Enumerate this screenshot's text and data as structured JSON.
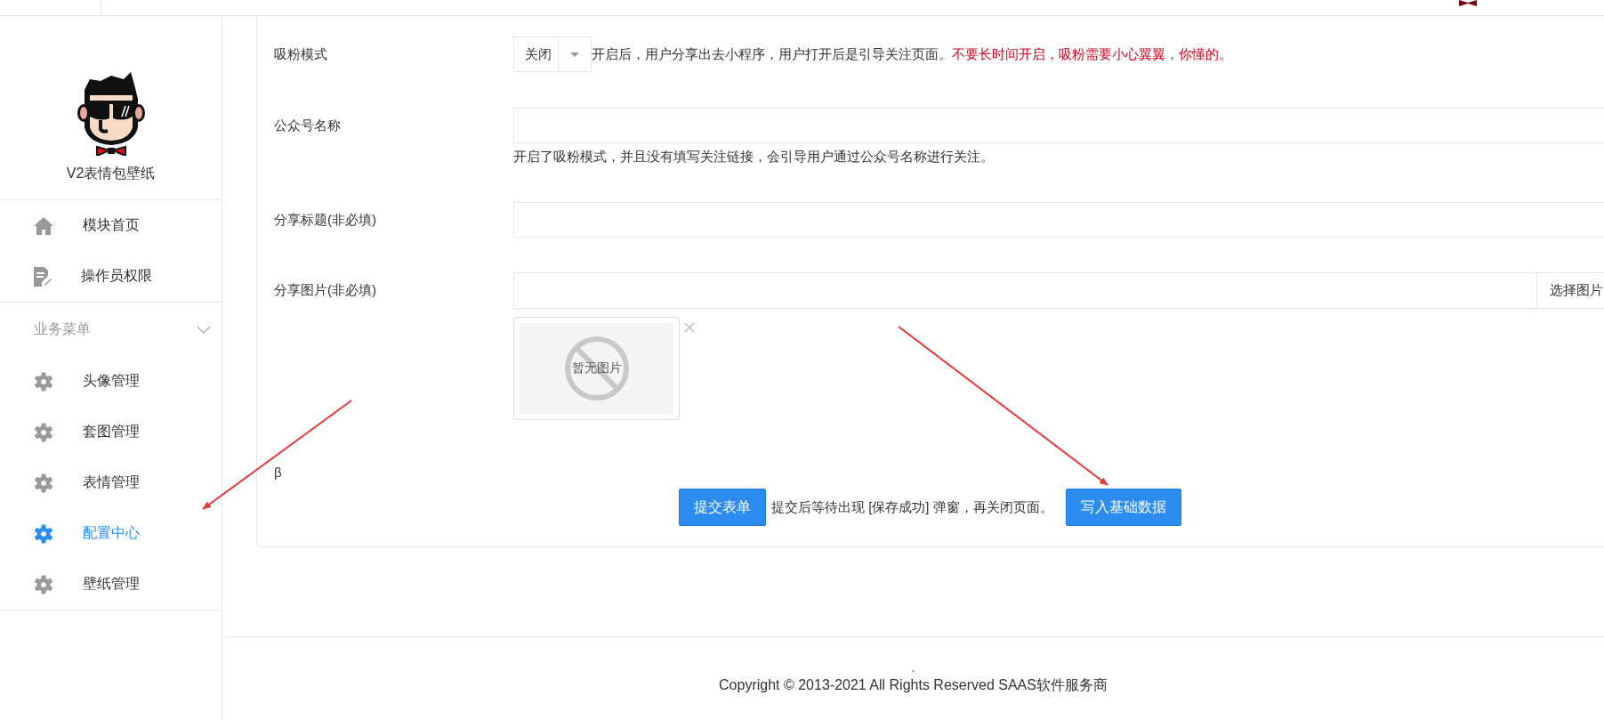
{
  "sidebar": {
    "app_name": "V2表情包壁纸",
    "items": [
      {
        "label": "模块首页",
        "selected": false
      },
      {
        "label": "操作员权限",
        "selected": false
      }
    ],
    "section": {
      "title": "业务菜单",
      "expanded": true,
      "items": [
        {
          "label": "头像管理",
          "selected": false
        },
        {
          "label": "套图管理",
          "selected": false
        },
        {
          "label": "表情管理",
          "selected": false
        },
        {
          "label": "配置中心",
          "selected": true
        },
        {
          "label": "壁纸管理",
          "selected": false
        }
      ]
    }
  },
  "form": {
    "rows": [
      {
        "kind": "select",
        "label": "吸粉模式",
        "value": "关闭",
        "hint": "开启后，用户分享出去小程序，用户打开后是引导关注页面。",
        "warning": "不要长时间开启，吸粉需要小心翼翼，你懂的。"
      },
      {
        "kind": "text",
        "label": "公众号名称",
        "help": "开启了吸粉模式，并且没有填写关注链接，会引导用户通过公众号名称进行关注。"
      },
      {
        "kind": "text",
        "label": "分享标题(非必填)"
      },
      {
        "kind": "image",
        "label": "分享图片(非必填)",
        "button": "选择图片",
        "preview": "暂无图片"
      }
    ],
    "stray_text": "β",
    "actions": {
      "submit": "提交表单",
      "note": "提交后等待出现 [保存成功] 弹窗，再关闭页面。",
      "seed": "写入基础数据"
    }
  },
  "footer": {
    "dot": ".",
    "copyright": "Copyright © 2013-2021 All Rights Reserved SAAS软件服务商"
  }
}
